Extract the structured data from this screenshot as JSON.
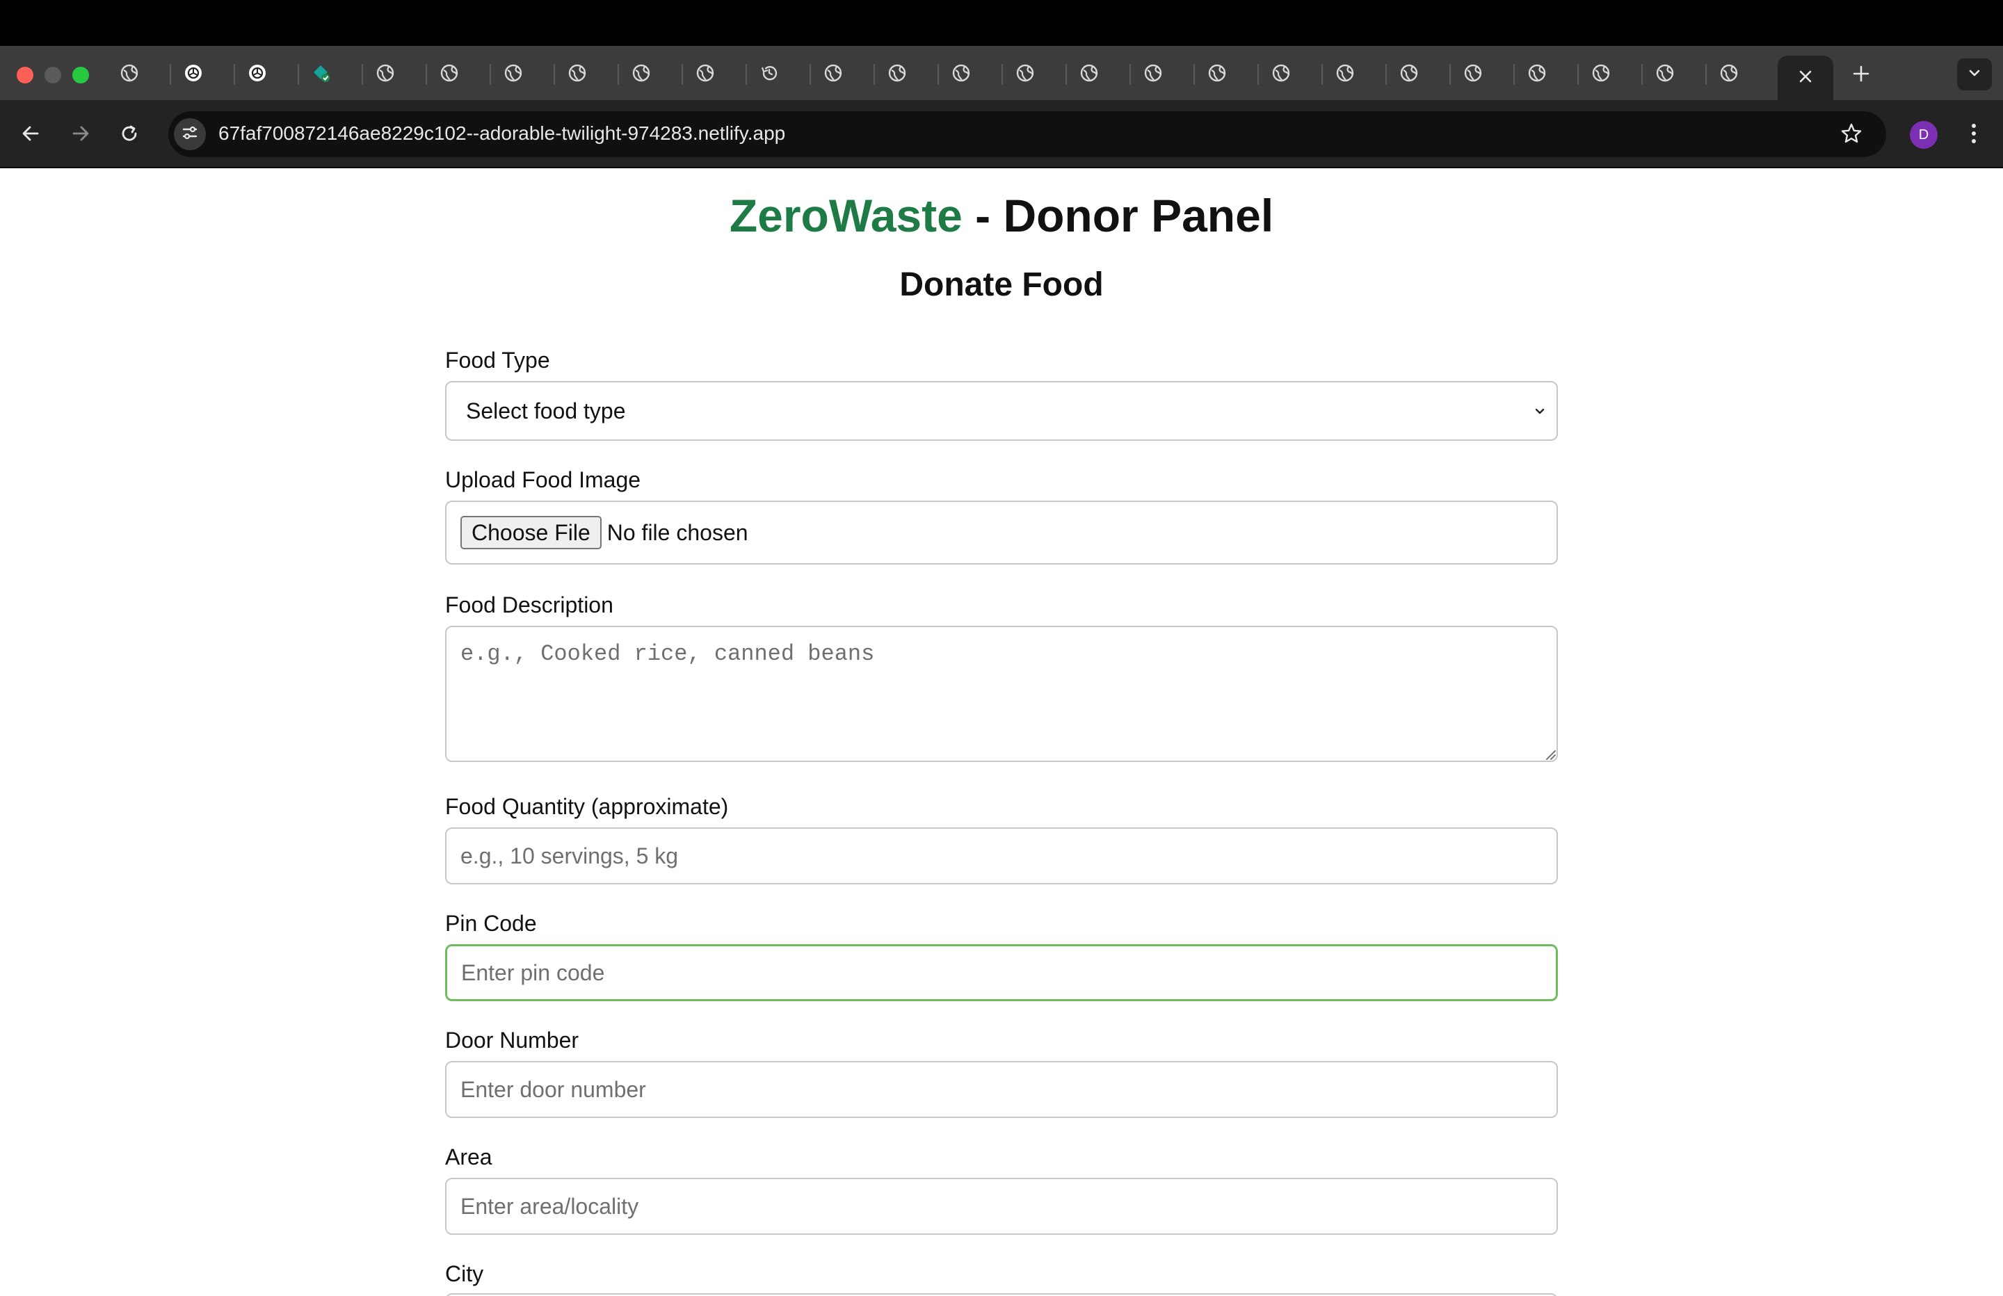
{
  "browser": {
    "url": "67faf700872146ae8229c102--adorable-twilight-974283.netlify.app",
    "profile_initial": "D",
    "tab_icons": [
      "globe-icon",
      "openai-icon",
      "openai-icon",
      "bookmark-check-icon",
      "globe-icon",
      "globe-icon",
      "globe-icon",
      "globe-icon",
      "globe-icon",
      "globe-icon",
      "history-icon",
      "globe-icon",
      "globe-icon",
      "globe-icon",
      "globe-icon",
      "globe-icon",
      "globe-icon",
      "globe-icon",
      "globe-icon",
      "globe-icon",
      "globe-icon",
      "globe-icon",
      "globe-icon",
      "globe-icon",
      "globe-icon",
      "globe-icon"
    ]
  },
  "page": {
    "brand": "ZeroWaste",
    "title_rest": " - Donor Panel",
    "subtitle": "Donate Food",
    "brand_color": "#1e7b45",
    "focus_color": "#6fbd5c"
  },
  "form": {
    "food_type": {
      "label": "Food Type",
      "selected": "Select food type"
    },
    "food_image": {
      "label": "Upload Food Image",
      "button": "Choose File",
      "status": "No file chosen"
    },
    "description": {
      "label": "Food Description",
      "placeholder": "e.g., Cooked rice, canned beans"
    },
    "quantity": {
      "label": "Food Quantity (approximate)",
      "placeholder": "e.g., 10 servings, 5 kg"
    },
    "pin_code": {
      "label": "Pin Code",
      "placeholder": "Enter pin code"
    },
    "door_number": {
      "label": "Door Number",
      "placeholder": "Enter door number"
    },
    "area": {
      "label": "Area",
      "placeholder": "Enter area/locality"
    },
    "city": {
      "label": "City"
    }
  }
}
